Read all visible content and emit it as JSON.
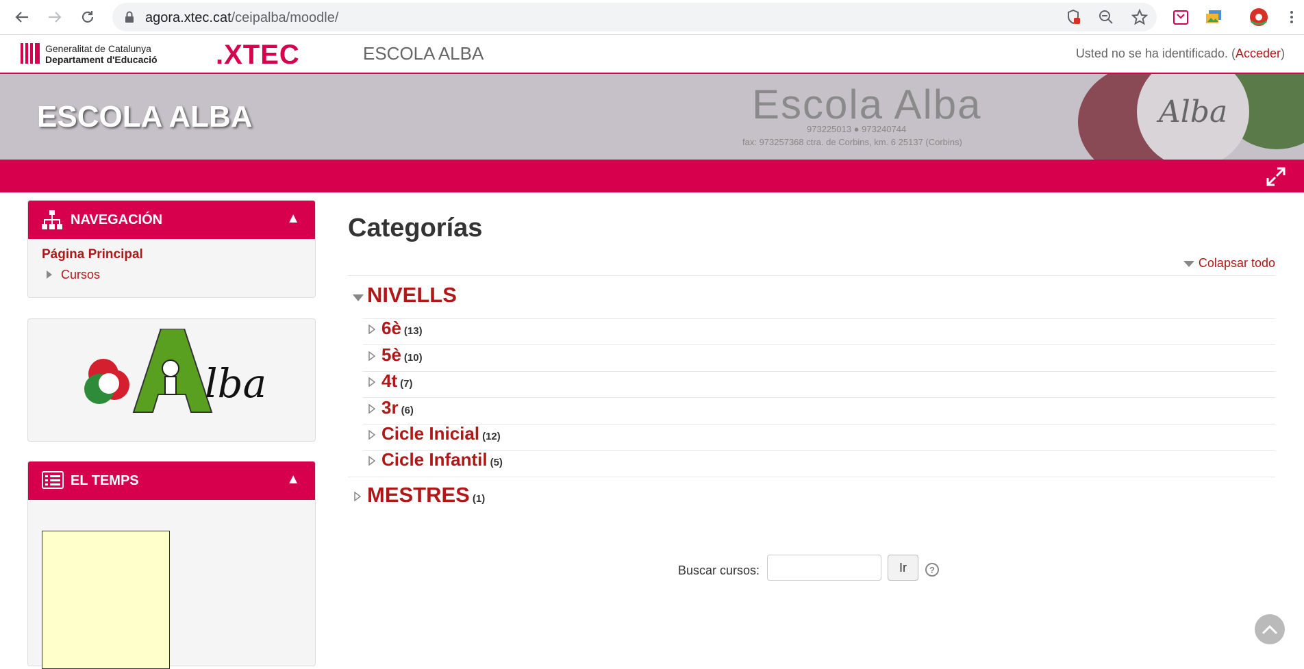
{
  "browser": {
    "url_domain": "agora.xtec.cat",
    "url_path": "/ceipalba/moodle/"
  },
  "header": {
    "gencat_line1": "Generalitat de Catalunya",
    "gencat_line2": "Departament d'Educació",
    "xtec_logo": ".XTEC",
    "site_name": "ESCOLA ALBA",
    "login_text": "Usted no se ha identificado. (",
    "login_link": "Acceder",
    "login_close": ")"
  },
  "banner": {
    "title": "ESCOLA ALBA",
    "logo_text": "Escola Alba",
    "logo_phone": "973225013 ● 973240744",
    "logo_address": "fax: 973257368 ctra. de Corbins, km. 6 25137 (Corbins)",
    "badge_text": "Alba"
  },
  "sidebar": {
    "navigation": {
      "title": "NAVEGACIÓN",
      "toggle": "▲",
      "home": "Página Principal",
      "courses": "Cursos"
    },
    "logo_block": {
      "text": "lba"
    },
    "weather": {
      "title": "EL TEMPS",
      "toggle": "▲"
    }
  },
  "main": {
    "title": "Categorías",
    "collapse_all": "Colapsar todo",
    "categories": [
      {
        "name": "NIVELLS",
        "expanded": true,
        "children": [
          {
            "name": "6è",
            "count": "(13)"
          },
          {
            "name": "5è",
            "count": "(10)"
          },
          {
            "name": "4t",
            "count": "(7)"
          },
          {
            "name": "3r",
            "count": "(6)"
          },
          {
            "name": "Cicle Inicial",
            "count": "(12)"
          },
          {
            "name": "Cicle Infantil",
            "count": "(5)"
          }
        ]
      },
      {
        "name": "MESTRES",
        "count": "(1)",
        "expanded": false
      }
    ],
    "search_label": "Buscar cursos:",
    "search_button": "Ir",
    "help": "?"
  },
  "colors": {
    "brand": "#d6004c",
    "link": "#b01818"
  }
}
